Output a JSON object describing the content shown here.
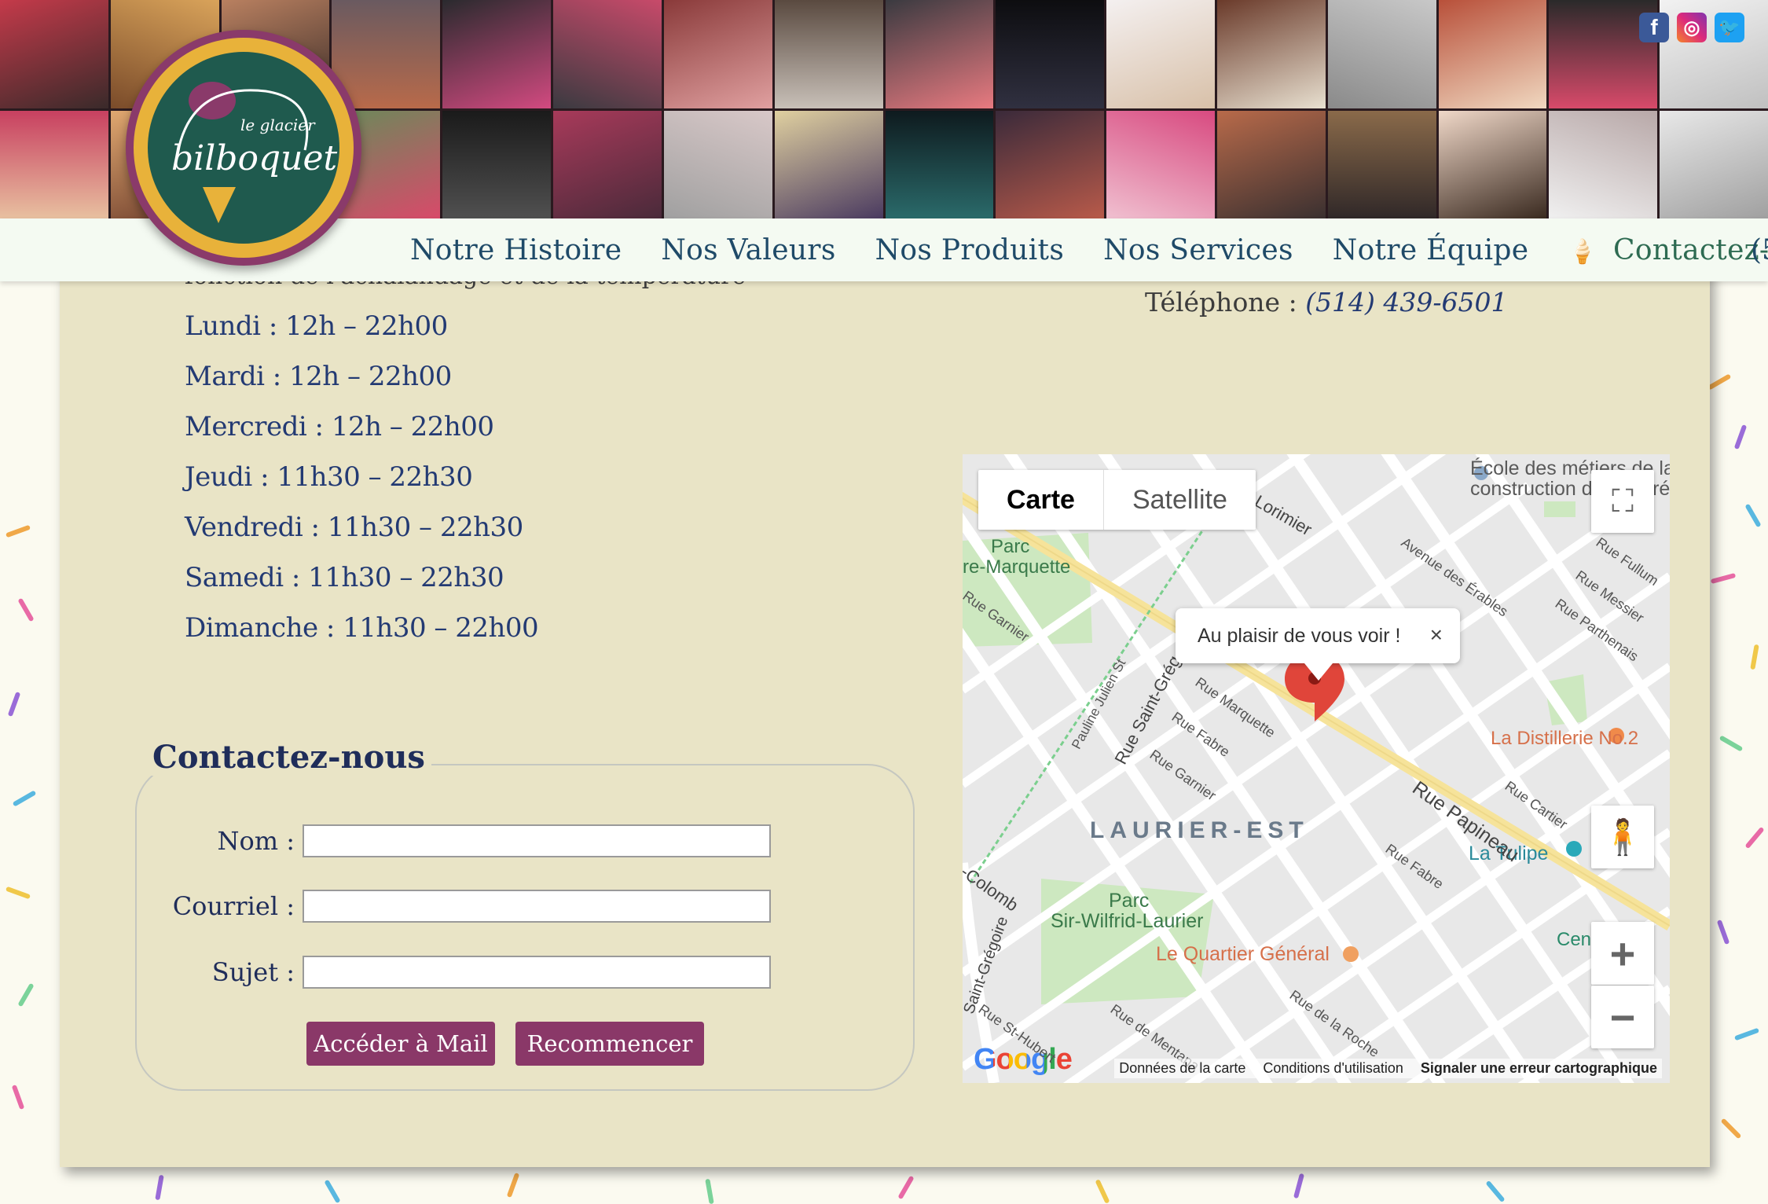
{
  "social": [
    {
      "name": "facebook-icon",
      "glyph": "f"
    },
    {
      "name": "instagram-icon",
      "glyph": "◎"
    },
    {
      "name": "twitter-icon",
      "glyph": "🐦"
    }
  ],
  "logo": {
    "text_top": "le glacier",
    "text_main": "bilboquet"
  },
  "nav": {
    "items": [
      "Notre Histoire",
      "Nos Valeurs",
      "Nos Produits",
      "Nos Services",
      "Notre Équipe"
    ],
    "contact": "Contactez-nous",
    "more": "(5"
  },
  "intro_cut": "fonction de l'achalandage et de la température",
  "hours": [
    "Lundi : 12h – 22h00",
    "Mardi : 12h – 22h00",
    "Mercredi : 12h – 22h00",
    "Jeudi : 11h30 – 22h30",
    "Vendredi : 11h30 – 22h30",
    "Samedi : 11h30 – 22h30",
    "Dimanche : 11h30 – 22h00"
  ],
  "phone": {
    "label": "Téléphone : ",
    "number": "(514) 439-6501"
  },
  "form": {
    "legend": "Contactez-nous",
    "name_label": "Nom :",
    "email_label": "Courriel :",
    "subject_label": "Sujet :",
    "name_value": "",
    "email_value": "",
    "subject_value": "",
    "submit": "Accéder à Mail",
    "reset": "Recommencer"
  },
  "map": {
    "tab_map": "Carte",
    "tab_satellite": "Satellite",
    "info": "Au plaisir de vous voir !",
    "close": "×",
    "zoom_in": "+",
    "zoom_out": "−",
    "brand": "Google",
    "footer_data": "Données de la carte",
    "footer_terms": "Conditions d'utilisation",
    "footer_report": "Signaler une erreur cartographique",
    "labels": {
      "ecole": "École des métiers de la",
      "construction": "construction de Montréal",
      "parc_marquette_1": "Parc",
      "parc_marquette_2": "re-Marquette",
      "laurier_est": "LAURIER-EST",
      "parc_wl_1": "Parc",
      "parc_wl_2": "Sir-Wilfrid-Laurier",
      "quartier": "Le Quartier Général",
      "distillerie": "La Distillerie No.2",
      "tulipe": "La Tulipe",
      "cen": "Cen",
      "rue_papineau": "Rue Papineau",
      "lorimier": "Av. de Lorimier",
      "erables": "Avenue des Érables",
      "fullum": "Rue Fullum",
      "messier": "Rue Messier",
      "parthenais": "Rue Parthenais",
      "garnier": "Rue Garnier",
      "marquette": "Rue Marquette",
      "fabre": "Rue Fabre",
      "saint_greg": "Rue Saint-Grég",
      "julien": "Pauline Julien St",
      "cartier": "Rue Cartier",
      "colomb": "-Colomb",
      "saint_gregoire": "Saint-Grégoire",
      "mentana": "Rue de Mentana",
      "roche": "Rue de la Roche",
      "st_hubert": "Rue St-Hubert",
      "fabre2": "Rue Fabre",
      "garnier2": "Rue Garnier"
    }
  },
  "colors": {
    "panel": "#e9e4c6",
    "nav_text": "#1f4a68",
    "button": "#8a3868",
    "hours_text": "#233a73"
  }
}
